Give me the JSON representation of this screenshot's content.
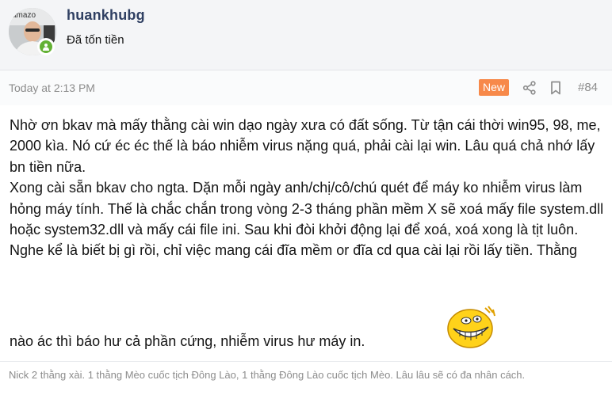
{
  "user": {
    "name": "huankhubg",
    "title": "Đã tốn tiền",
    "avatar_label": "amazo"
  },
  "post": {
    "timestamp": "Today at 2:13 PM",
    "new_label": "New",
    "number": "#84",
    "paragraphs": [
      "Nhờ ơn bkav mà mấy thằng cài win dạo ngày xưa có đất sống. Từ tận cái thời win95, 98, me, 2000 kìa. Nó cứ éc éc thế là báo nhiễm virus nặng quá, phải cài lại win. Lâu quá chả nhớ lấy bn tiền nữa.",
      "Xong cài sẵn bkav cho ngta. Dặn mỗi ngày anh/chị/cô/chú quét để máy ko nhiễm virus làm hỏng máy tính. Thế là chắc chắn trong vòng 2-3 tháng phần mềm X sẽ xoá mấy file system.dll hoặc system32.dll và mấy cái file ini. Sau khi đòi khởi động lại để xoá, xoá xong là tịt luôn. Nghe kể là biết bị gì rồi, chỉ việc mang cái đĩa mềm or đĩa cd qua cài lại rồi lấy tiền. Thằng"
    ],
    "last_line": "nào ác thì báo hư cả phần cứng, nhiễm virus hư máy in.",
    "emoji": "grinning-smiley-emoji"
  },
  "signature": "Nick 2 thằng xài. 1 thằng Mèo cuốc tịch Đông Lào, 1 thằng Đông Lào cuốc tịch Mèo. Lâu lâu sẽ có đa nhân cách.",
  "icons": {
    "share": "share-icon",
    "bookmark": "bookmark-icon",
    "online": "online-status-icon"
  },
  "colors": {
    "username": "#2f3f62",
    "new_badge": "#f7894a",
    "online": "#63b134",
    "meta_text": "#8c8c8c"
  }
}
